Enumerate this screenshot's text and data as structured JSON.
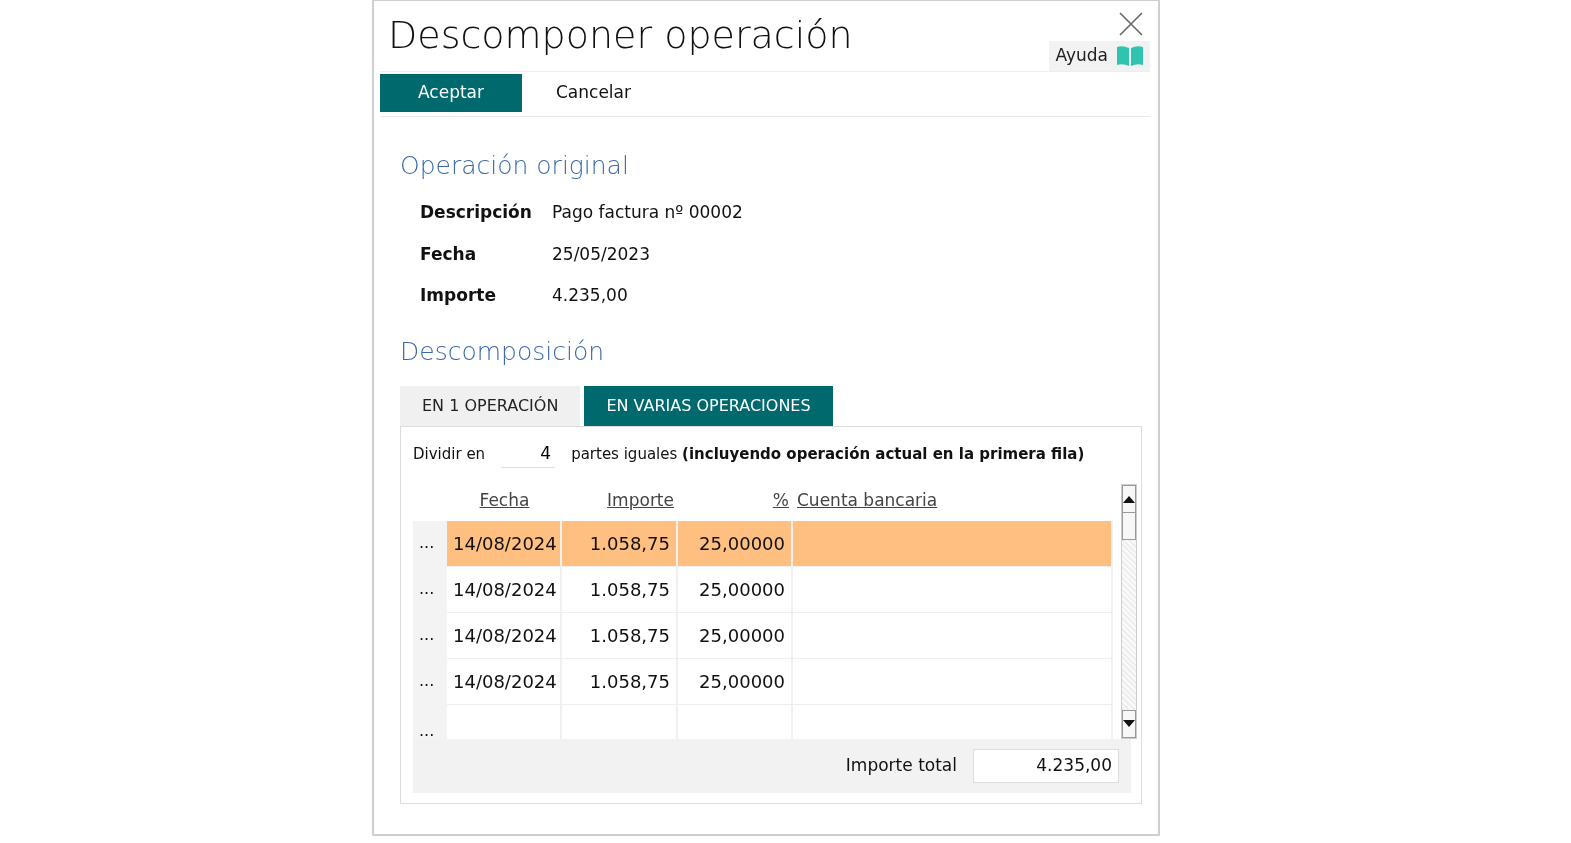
{
  "dialog": {
    "title": "Descomponer operación",
    "help_label": "Ayuda"
  },
  "toolbar": [
    {
      "label": "Aceptar",
      "kind": "primary"
    },
    {
      "label": "Cancelar",
      "kind": "plain"
    }
  ],
  "original": {
    "heading": "Operación original",
    "fields": [
      {
        "label": "Descripción",
        "value": "Pago factura nº 00002"
      },
      {
        "label": "Fecha",
        "value": "25/05/2023"
      },
      {
        "label": "Importe",
        "value": "4.235,00"
      }
    ]
  },
  "breakdown": {
    "heading": "Descomposición",
    "tabs": [
      {
        "label": "EN 1 OPERACIÓN",
        "selected": false
      },
      {
        "label": "EN VARIAS OPERACIONES",
        "selected": true
      }
    ],
    "split": {
      "prefix": "Dividir en",
      "count": "4",
      "suffix": "partes iguales **(incluyendo operación actual en la primera fila)**"
    },
    "columns": [
      "Fecha",
      "Importe",
      "%",
      "Cuenta bancaria"
    ],
    "rows": [
      {
        "marker": "...",
        "cells": [
          "14/08/2024",
          "1.058,75",
          "25,00000"
        ],
        "selected": true
      },
      {
        "marker": "...",
        "cells": [
          "14/08/2024",
          "1.058,75",
          "25,00000"
        ],
        "selected": false
      },
      {
        "marker": "...",
        "cells": [
          "14/08/2024",
          "1.058,75",
          "25,00000"
        ],
        "selected": false
      },
      {
        "marker": "...",
        "cells": [
          "14/08/2024",
          "1.058,75",
          "25,00000"
        ],
        "selected": false
      },
      {
        "marker": "...",
        "cells": [],
        "selected": false
      }
    ],
    "total_label": "Importe total",
    "total_value": "4.235,00"
  }
}
